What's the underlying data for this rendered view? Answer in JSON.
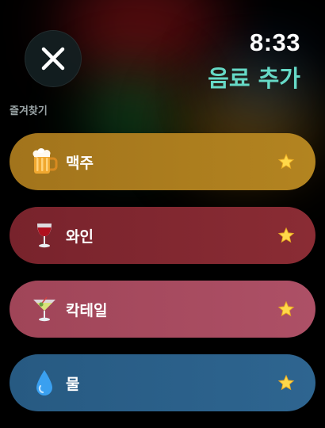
{
  "header": {
    "time": "8:33",
    "title": "음료 추가"
  },
  "section": {
    "label": "즐겨찾기"
  },
  "drinks": [
    {
      "label": "맥주",
      "icon": "beer-mug-icon",
      "color": "#a8791d"
    },
    {
      "label": "와인",
      "icon": "wine-glass-icon",
      "color": "#7e2830"
    },
    {
      "label": "칵테일",
      "icon": "cocktail-glass-icon",
      "color": "#a64a60"
    },
    {
      "label": "물",
      "icon": "water-drop-icon",
      "color": "#2a5c84"
    }
  ],
  "colors": {
    "accent": "#66d9c6",
    "star": "#ffd84a"
  }
}
